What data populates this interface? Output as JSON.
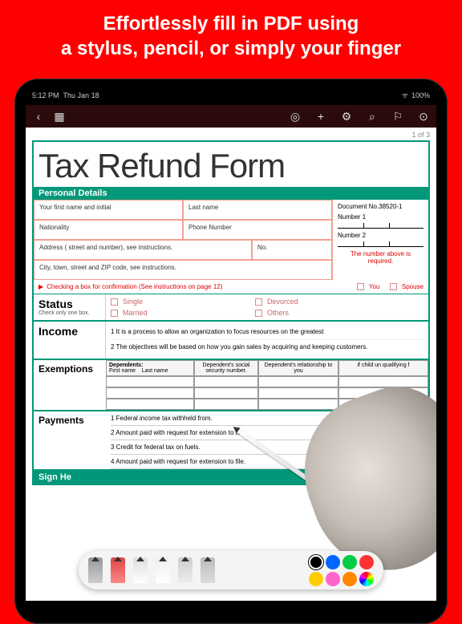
{
  "promo": {
    "line1": "Effortlessly fill in PDF using",
    "line2": "a stylus, pencil, or simply your finger"
  },
  "statusbar": {
    "time": "5:12 PM",
    "date": "Thu Jan 18",
    "battery": "100%"
  },
  "page_indicator": "1 of 3",
  "doc": {
    "title": "Tax Refund Form",
    "sections": {
      "personal": "Personal Details",
      "sign": "Sign He"
    },
    "fields": {
      "first_name": "Your first name and initial",
      "last_name": "Last name",
      "nationality": "Nationality",
      "phone": "Phone Number",
      "address": "Address ( street and number), see instructions.",
      "no": "No.",
      "city": "City, town, street and ZIP code, see instructions.",
      "doc_no_label": "Document No.",
      "doc_no": "38520-1",
      "number1": "Number 1",
      "number2": "Number 2",
      "required": "The number above is required."
    },
    "confirm": {
      "text": "Checking a box for confirmation (See instructions on page 12)",
      "you": "You",
      "spouse": "Spouse"
    },
    "status": {
      "title": "Status",
      "sub": "Check only one box.",
      "opts": [
        "Single",
        "Devorced",
        "Married",
        "Others"
      ]
    },
    "income": {
      "title": "Income",
      "lines": [
        "1  It is a process to allow an organization to focus resources on the greatest",
        "2  The objectives will be based on how you gain sales by acquiring and keeping customers."
      ]
    },
    "exemptions": {
      "title": "Exemptions",
      "headers": {
        "dep": "Dependents:",
        "fn": "First name",
        "ln": "Last name",
        "ssn": "Dependent's social security number.",
        "rel": "Dependent's relationship to you",
        "qual": "if child un qualifying f"
      }
    },
    "payments": {
      "title": "Payments",
      "lines": [
        "1  Federal income tax withheld from.",
        "2  Amount paid with request for extension to file.",
        "3 Credit for federal tax on fuels.",
        "4  Amount paid with request for extension to file."
      ]
    }
  },
  "palette": {
    "colors": [
      "#000000",
      "#0066ff",
      "#00cc44",
      "#ff3333",
      "#ffcc00",
      "#ff66cc",
      "#ff8800",
      "#888888"
    ]
  }
}
